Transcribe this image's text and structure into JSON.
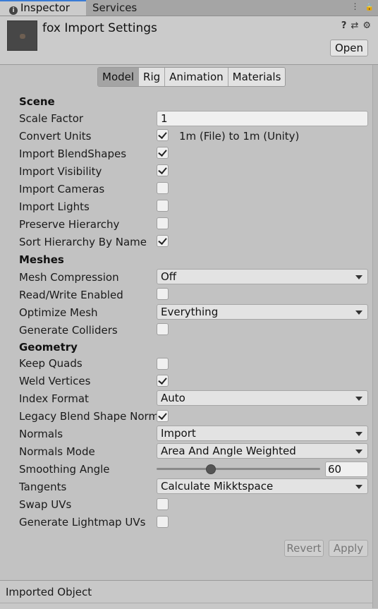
{
  "tabs": {
    "inspector": "Inspector",
    "services": "Services",
    "info_icon_glyph": "i",
    "menu_glyph": "⋮",
    "lock_glyph": "🔒"
  },
  "header": {
    "title": "fox Import Settings",
    "open_label": "Open",
    "help_glyph": "?",
    "presets_glyph": "⇄",
    "settings_glyph": "⚙"
  },
  "model_tabs": [
    "Model",
    "Rig",
    "Animation",
    "Materials"
  ],
  "sections": {
    "scene": "Scene",
    "meshes": "Meshes",
    "geometry": "Geometry"
  },
  "fields": {
    "scale_factor": {
      "label": "Scale Factor",
      "value": "1"
    },
    "convert_units": {
      "label": "Convert Units",
      "checked": true,
      "note": "1m (File) to 1m (Unity)"
    },
    "import_blendshapes": {
      "label": "Import BlendShapes",
      "checked": true
    },
    "import_visibility": {
      "label": "Import Visibility",
      "checked": true
    },
    "import_cameras": {
      "label": "Import Cameras",
      "checked": false
    },
    "import_lights": {
      "label": "Import Lights",
      "checked": false
    },
    "preserve_hierarchy": {
      "label": "Preserve Hierarchy",
      "checked": false
    },
    "sort_hierarchy": {
      "label": "Sort Hierarchy By Name",
      "checked": true
    },
    "mesh_compression": {
      "label": "Mesh Compression",
      "value": "Off"
    },
    "read_write": {
      "label": "Read/Write Enabled",
      "checked": false
    },
    "optimize_mesh": {
      "label": "Optimize Mesh",
      "value": "Everything"
    },
    "generate_colliders": {
      "label": "Generate Colliders",
      "checked": false
    },
    "keep_quads": {
      "label": "Keep Quads",
      "checked": false
    },
    "weld_vertices": {
      "label": "Weld Vertices",
      "checked": true
    },
    "index_format": {
      "label": "Index Format",
      "value": "Auto"
    },
    "legacy_blend": {
      "label": "Legacy Blend Shape Norma",
      "checked": true
    },
    "normals": {
      "label": "Normals",
      "value": "Import"
    },
    "normals_mode": {
      "label": "Normals Mode",
      "value": "Area And Angle Weighted"
    },
    "smoothing_angle": {
      "label": "Smoothing Angle",
      "value": "60",
      "max": 180
    },
    "tangents": {
      "label": "Tangents",
      "value": "Calculate Mikktspace"
    },
    "swap_uvs": {
      "label": "Swap UVs",
      "checked": false
    },
    "lightmap_uvs": {
      "label": "Generate Lightmap UVs",
      "checked": false
    }
  },
  "actions": {
    "revert": "Revert",
    "apply": "Apply"
  },
  "footer": {
    "label": "Imported Object"
  }
}
